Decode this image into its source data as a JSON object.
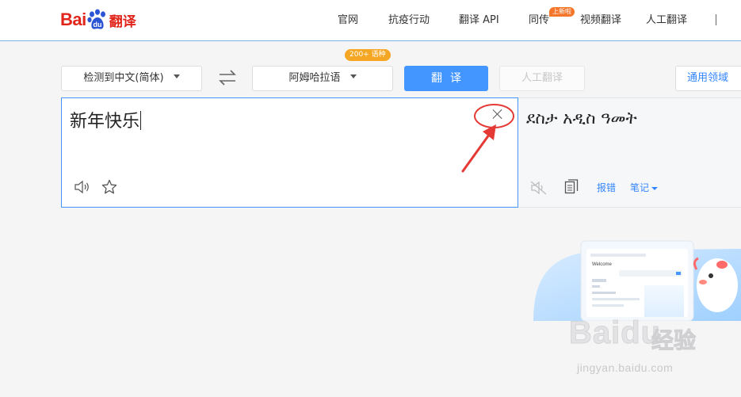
{
  "header": {
    "logo": {
      "text_bai": "Bai",
      "text_du": "du",
      "text_fanyi": "翻译"
    },
    "nav": [
      {
        "label": "官网"
      },
      {
        "label": "抗疫行动"
      },
      {
        "label": "翻译 API"
      },
      {
        "label": "同传",
        "badge": "上新啦"
      },
      {
        "label": "视频翻译"
      },
      {
        "label": "人工翻译"
      }
    ]
  },
  "toolbar": {
    "source_lang": "检测到中文(简体)",
    "swap_icon": "swap-arrows-icon",
    "target_lang": "阿姆哈拉语",
    "target_lang_badge": "200+ 语种",
    "translate_label": "翻译",
    "human_translate_label": "人工翻译",
    "domain_label": "通用领域"
  },
  "source": {
    "text": "新年快乐",
    "clear_icon": "close-icon",
    "speaker_icon": "speaker-icon",
    "favorite_icon": "star-icon"
  },
  "target": {
    "text": "ደስታ አዲስ ዓመት",
    "speaker_icon": "speaker-muted-icon",
    "copy_icon": "copy-icon",
    "report_label": "报错",
    "notes_label": "笔记"
  },
  "promo": {
    "welcome_label": "Welcome"
  },
  "watermark": {
    "brand": "Baidu",
    "cn": "经验",
    "url": "jingyan.baidu.com"
  },
  "colors": {
    "brand_red": "#e1251b",
    "primary_blue": "#4395ff",
    "link_blue": "#3385ff",
    "annotation_red": "#e53935",
    "badge_orange": "#f5a623"
  }
}
